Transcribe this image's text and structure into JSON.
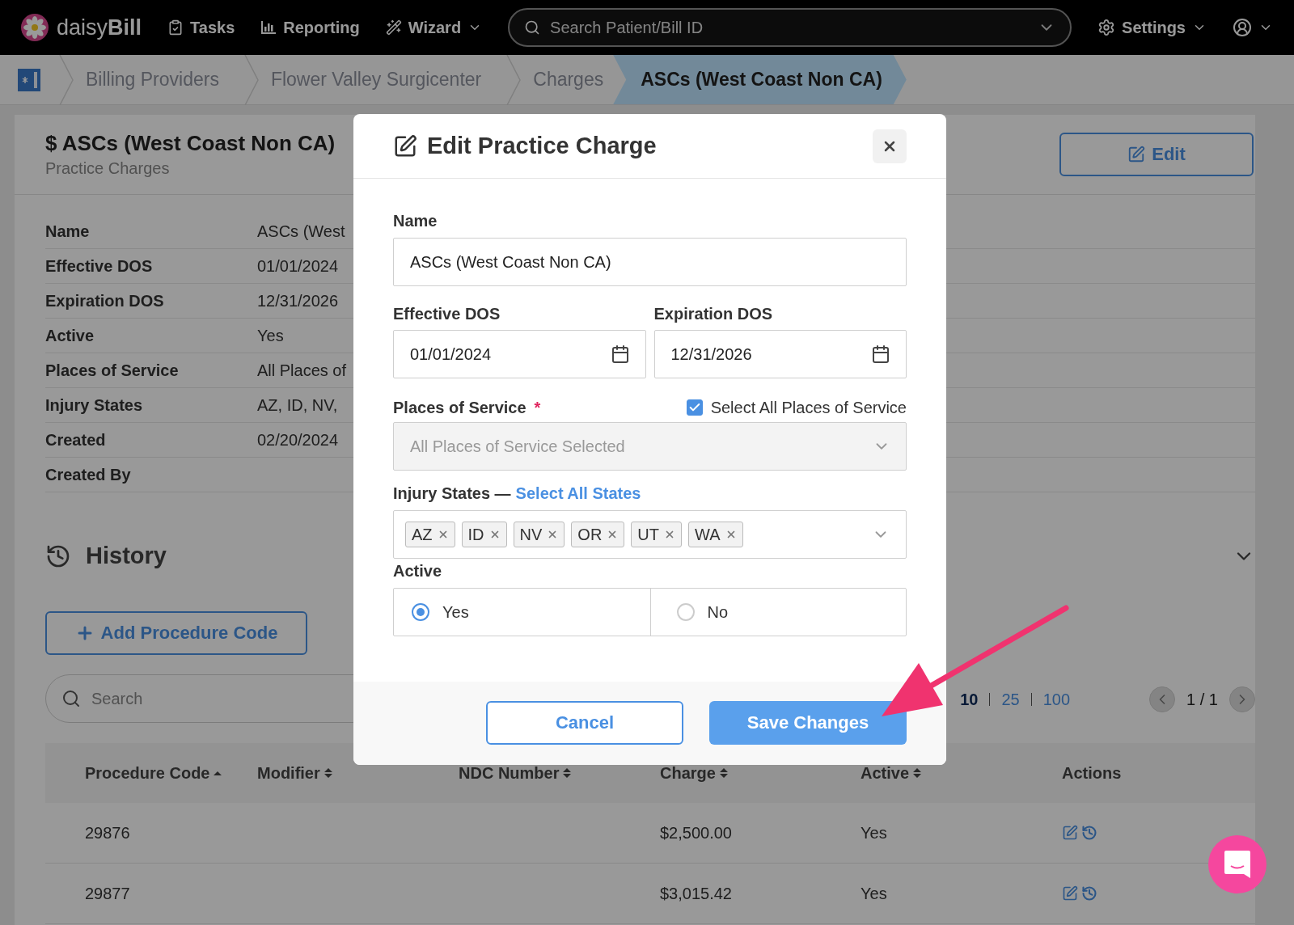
{
  "nav": {
    "brand": "daisy**Bill**",
    "items": [
      {
        "label": "Tasks",
        "kind": "tasks",
        "dropdown": false
      },
      {
        "label": "Reporting",
        "kind": "reporting",
        "dropdown": false
      },
      {
        "label": "Wizard",
        "kind": "wizard",
        "dropdown": true
      }
    ],
    "search": {
      "placeholder": "Search Patient/Bill ID"
    },
    "settings": "Settings"
  },
  "breadcrumbs": [
    {
      "label": "Billing Providers",
      "selected": false
    },
    {
      "label": "Flower Valley Surgicenter",
      "selected": false
    },
    {
      "label": "Charges",
      "selected": false
    },
    {
      "label": "ASCs (West Coast Non CA)",
      "selected": true
    }
  ],
  "header": {
    "title": "$ ASCs (West Coast Non CA)",
    "subtitle": "Practice Charges",
    "edit_button": "Edit"
  },
  "details": [
    {
      "label": "Name",
      "value": "ASCs (West"
    },
    {
      "label": "Effective DOS",
      "value": "01/01/2024"
    },
    {
      "label": "Expiration DOS",
      "value": "12/31/2026"
    },
    {
      "label": "Active",
      "value": "Yes"
    },
    {
      "label": "Places of Service",
      "value": "All Places of"
    },
    {
      "label": "Injury States",
      "value": "AZ, ID, NV,"
    },
    {
      "label": "Created",
      "value": "02/20/2024"
    },
    {
      "label": "Created By"
    }
  ],
  "history": {
    "title": "History",
    "add_button": "Add Procedure Code",
    "search": {
      "placeholder": "Search"
    },
    "page_sizes": [
      {
        "label": "10",
        "selected": true
      },
      {
        "label": "25",
        "selected": false
      },
      {
        "label": "100",
        "selected": false
      }
    ],
    "pagination": "1 / 1",
    "table": {
      "columns": [
        {
          "label": "Procedure Code",
          "sorted": true
        },
        {
          "label": "Modifier",
          "sorted": false
        },
        {
          "label": "NDC Number",
          "sorted": false
        },
        {
          "label": "Charge",
          "sorted": false
        },
        {
          "label": "Active",
          "sorted": false
        },
        {
          "label": "Actions"
        }
      ],
      "rows": [
        {
          "procedure_code": "29876",
          "charge": "$2,500.00",
          "active": "Yes"
        },
        {
          "procedure_code": "29877",
          "charge": "$3,015.42",
          "active": "Yes"
        }
      ]
    }
  },
  "modal": {
    "title": "Edit Practice Charge",
    "name": {
      "label": "Name",
      "value": "ASCs (West Coast Non CA)"
    },
    "effective": {
      "label": "Effective DOS",
      "value": "01/01/2024"
    },
    "expiration": {
      "label": "Expiration DOS",
      "value": "12/31/2026"
    },
    "places": {
      "label": "Places of Service",
      "required_mark": "*",
      "select_all": {
        "label": "Select All Places of Service",
        "checked": true
      },
      "value": "All Places of Service Selected",
      "disabled": true
    },
    "states": {
      "label": "Injury States —",
      "link": "Select All States",
      "tags": [
        "AZ",
        "ID",
        "NV",
        "OR",
        "UT",
        "WA"
      ]
    },
    "active": {
      "label": "Active",
      "options": [
        {
          "label": "Yes",
          "selected": true
        },
        {
          "label": "No",
          "selected": false
        }
      ]
    },
    "cancel": "Cancel",
    "save": "Save Changes"
  }
}
